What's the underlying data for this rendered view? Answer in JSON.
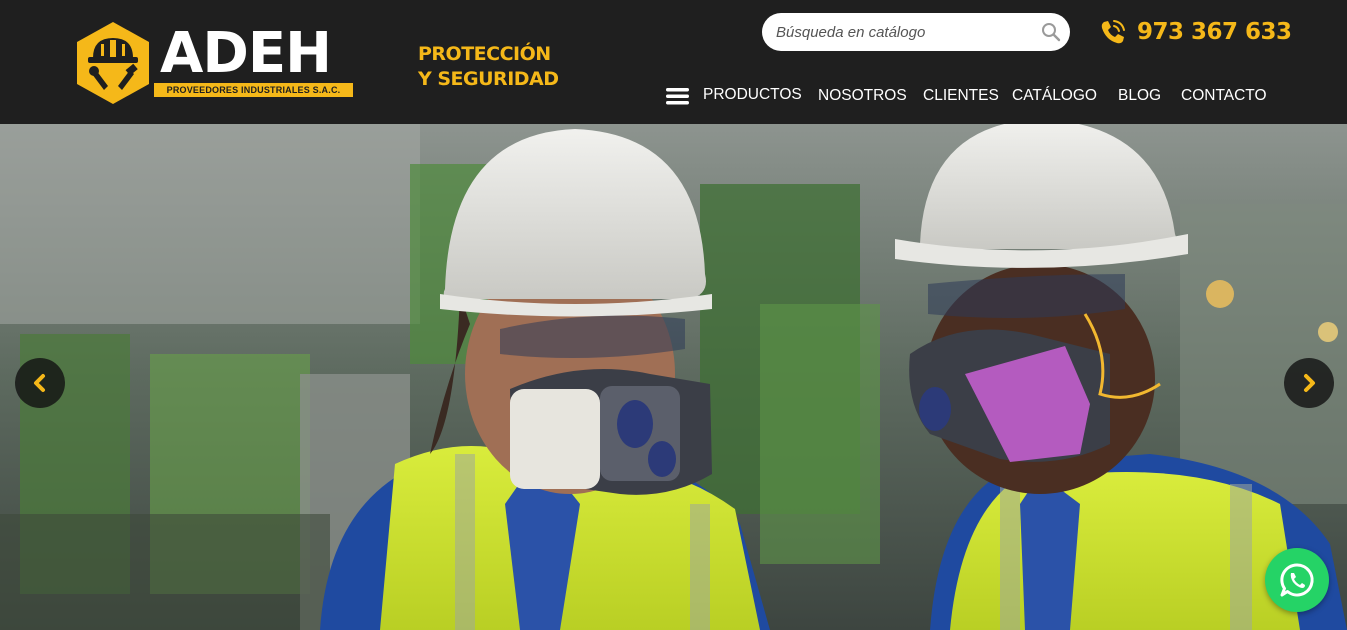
{
  "brand": {
    "name": "ADEH",
    "subtitle": "PROVEEDORES INDUSTRIALES S.A.C.",
    "logo_icon": "hardhat-tools-badge-icon",
    "tagline_line1": "PROTECCIÓN",
    "tagline_line2": "Y SEGURIDAD"
  },
  "search": {
    "placeholder": "Búsqueda en catálogo",
    "value": "",
    "icon": "search-icon"
  },
  "contact": {
    "phone": "973 367 633",
    "icon": "phone-icon"
  },
  "nav": {
    "menu_icon": "hamburger-menu-icon",
    "items": [
      {
        "label": "PRODUCTOS"
      },
      {
        "label": "NOSOTROS"
      },
      {
        "label": "CLIENTES"
      },
      {
        "label": "CATÁLOGO"
      },
      {
        "label": "BLOG"
      },
      {
        "label": "CONTACTO"
      }
    ]
  },
  "hero": {
    "image": "two workers in hard hats, safety glasses, respirators and hi-vis vests",
    "prev_icon": "chevron-left-icon",
    "next_icon": "chevron-right-icon"
  },
  "floating": {
    "whatsapp_icon": "whatsapp-icon"
  },
  "colors": {
    "header_bg": "#1f1f1f",
    "accent": "#f5b819",
    "nav_text": "#ffffff",
    "whatsapp": "#25d366"
  }
}
